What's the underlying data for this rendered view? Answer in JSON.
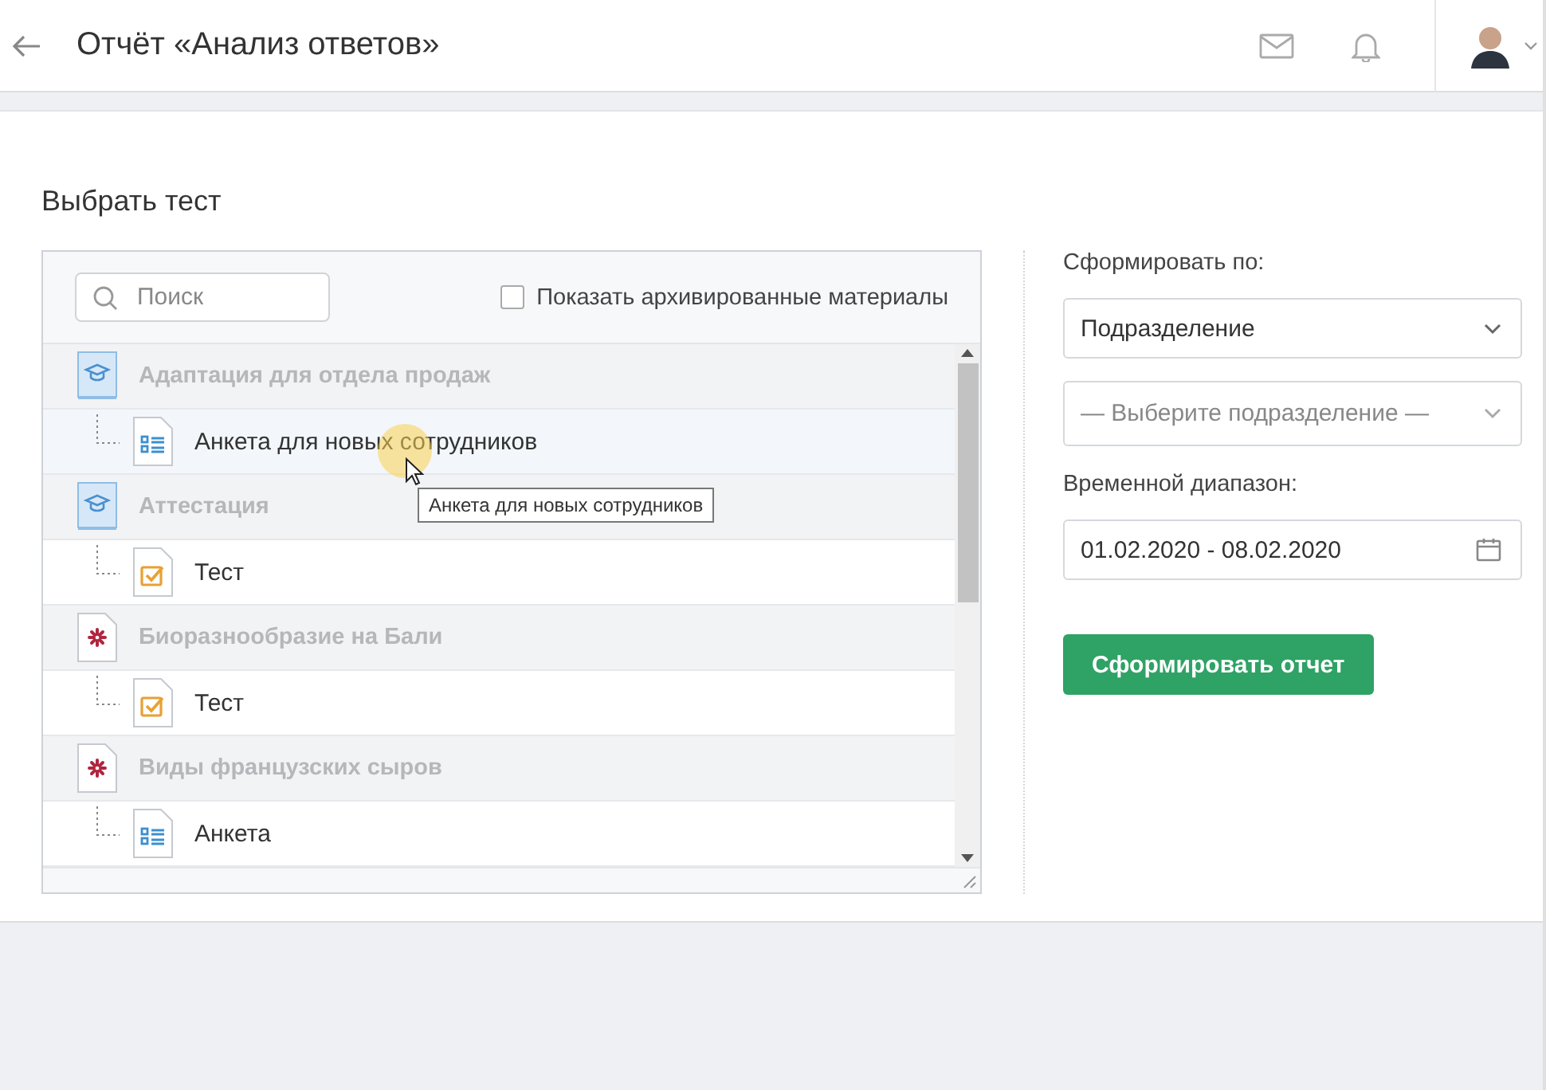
{
  "header": {
    "title": "Отчёт «Анализ ответов»"
  },
  "section_title": "Выбрать тест",
  "search": {
    "placeholder": "Поиск"
  },
  "archive_toggle": {
    "label": "Показать архивированные материалы",
    "checked": false
  },
  "tree": [
    {
      "kind": "course",
      "label": "Адаптация для отдела продаж",
      "children": [
        {
          "kind": "survey",
          "label": "Анкета для новых сотрудников",
          "hovered": true
        }
      ]
    },
    {
      "kind": "course",
      "label": "Аттестация",
      "children": [
        {
          "kind": "test",
          "label": "Тест",
          "hovered": false
        }
      ]
    },
    {
      "kind": "material",
      "label": "Биоразнообразие на Бали",
      "children": [
        {
          "kind": "test",
          "label": "Тест",
          "hovered": false
        }
      ]
    },
    {
      "kind": "material",
      "label": "Виды французских сыров",
      "children": [
        {
          "kind": "survey",
          "label": "Анкета",
          "hovered": false
        }
      ]
    }
  ],
  "tooltip": "Анкета для новых сотрудников",
  "form": {
    "group_by_label": "Сформировать по:",
    "group_by_value": "Подразделение",
    "unit_placeholder": "— Выберите подразделение —",
    "range_label": "Временной диапазон:",
    "range_value": "01.02.2020 - 08.02.2020",
    "submit": "Сформировать отчет"
  }
}
